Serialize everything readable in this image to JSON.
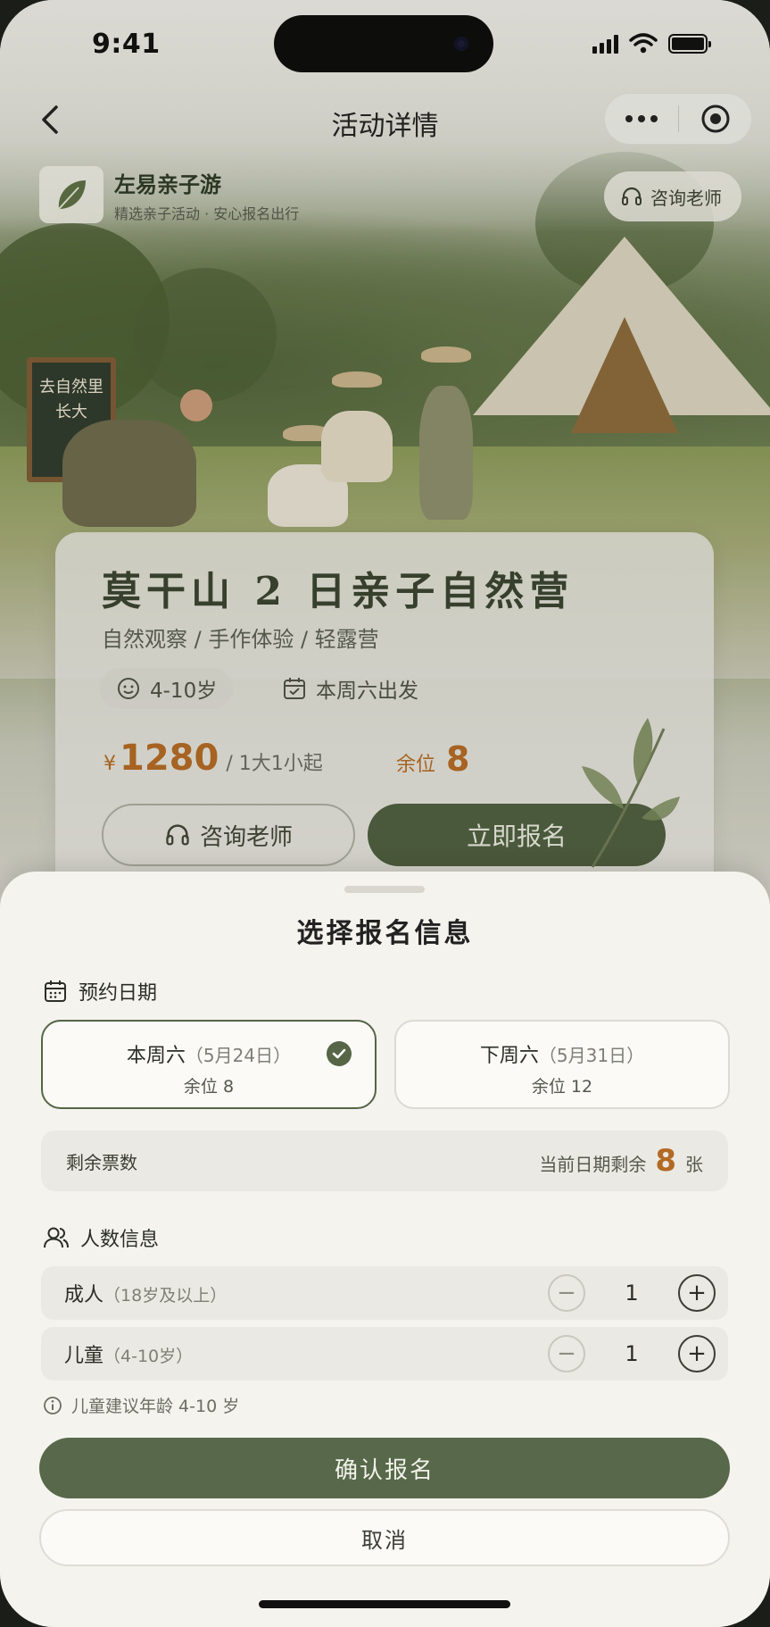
{
  "status": {
    "time": "9:41"
  },
  "nav": {
    "title": "活动详情"
  },
  "brand": {
    "name": "左易亲子游",
    "subtitle": "精选亲子活动 · 安心报名出行",
    "consult_label": "咨询老师"
  },
  "scene": {
    "chalkboard_line1": "去自然里",
    "chalkboard_line2": "长大"
  },
  "activity": {
    "title": "莫干山 2 日亲子自然营",
    "subtitle": "自然观察 / 手作体验 / 轻露营",
    "age_chip": "4-10岁",
    "date_chip": "本周六出发",
    "currency": "¥",
    "price": "1280",
    "price_unit": "/ 1大1小起",
    "remaining_label": "余位",
    "remaining_value": "8",
    "consult_button": "咨询老师",
    "signup_button": "立即报名"
  },
  "sheet": {
    "title": "选择报名信息",
    "date_section_label": "预约日期",
    "date_options": [
      {
        "day": "本周六",
        "date": "（5月24日）",
        "seats": "余位 8",
        "selected": true
      },
      {
        "day": "下周六",
        "date": "（5月31日）",
        "seats": "余位 12",
        "selected": false
      }
    ],
    "tickets": {
      "label": "剩余票数",
      "prefix": "当前日期剩余",
      "count": "8",
      "suffix": "张"
    },
    "people_section_label": "人数信息",
    "people": [
      {
        "label": "成人",
        "range": "（18岁及以上）",
        "value": "1"
      },
      {
        "label": "儿童",
        "range": "（4-10岁）",
        "value": "1"
      }
    ],
    "stepper_minus": "−",
    "stepper_plus": "+",
    "hint": "儿童建议年龄 4-10 岁",
    "confirm_button": "确认报名",
    "cancel_button": "取消"
  },
  "colors": {
    "accent_green": "#566546",
    "price_orange": "#b26a24",
    "sheet_bg": "#f4f3ee"
  },
  "icons": [
    "back-icon",
    "more-icon",
    "target-icon",
    "leaf-logo-icon",
    "headset-icon",
    "face-icon",
    "calendar-icon",
    "check-icon",
    "users-icon",
    "info-icon"
  ]
}
